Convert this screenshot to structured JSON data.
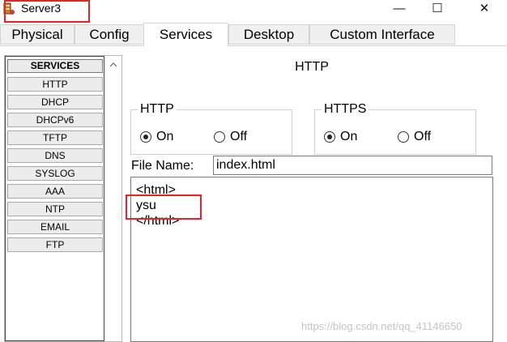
{
  "window": {
    "title": "Server3",
    "controls": {
      "minimize": "—",
      "maximize": "☐",
      "close": "✕"
    }
  },
  "tabs": [
    {
      "label": "Physical",
      "active": false
    },
    {
      "label": "Config",
      "active": false
    },
    {
      "label": "Services",
      "active": true
    },
    {
      "label": "Desktop",
      "active": false
    },
    {
      "label": "Custom Interface",
      "active": false
    }
  ],
  "sidebar": {
    "header": "SERVICES",
    "items": [
      "HTTP",
      "DHCP",
      "DHCPv6",
      "TFTP",
      "DNS",
      "SYSLOG",
      "AAA",
      "NTP",
      "EMAIL",
      "FTP"
    ]
  },
  "main": {
    "title": "HTTP",
    "http_group": {
      "label": "HTTP",
      "on": "On",
      "off": "Off",
      "selected": "On"
    },
    "https_group": {
      "label": "HTTPS",
      "on": "On",
      "off": "Off",
      "selected": "On"
    },
    "file_name_label": "File Name:",
    "file_name_value": "index.html",
    "editor_lines": [
      "<html>",
      "ysu",
      "</html>"
    ]
  },
  "watermark": "https://blog.csdn.net/qq_41146650",
  "colors": {
    "annotation": "#e8222a"
  }
}
